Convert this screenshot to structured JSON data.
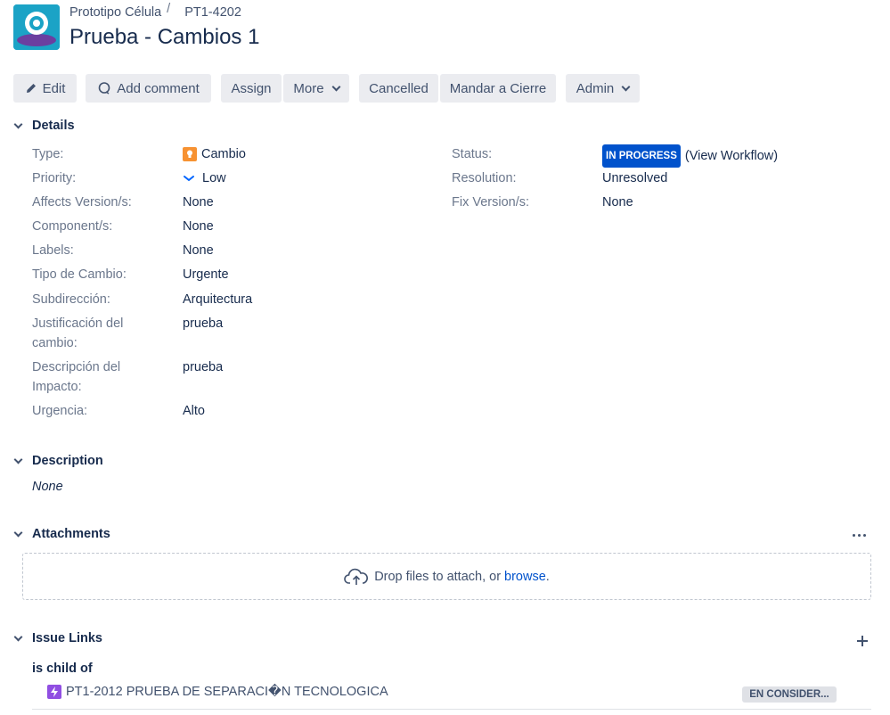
{
  "header": {
    "project_name": "Prototipo Célula",
    "issue_key": "PT1-4202",
    "title": "Prueba - Cambios 1"
  },
  "toolbar": {
    "edit": "Edit",
    "comment": "Comment",
    "comment_full": "Comment",
    "assign": "Assign",
    "more": "More",
    "cancelled": "Cancelled",
    "mandar": "Mandar a Cierre",
    "admin": "Admin"
  },
  "details": {
    "heading": "Details",
    "left": [
      {
        "label": "Type:",
        "value": "Cambio"
      },
      {
        "label": "Priority:",
        "value": "Low"
      },
      {
        "label": "Affects Version/s:",
        "value": "None"
      },
      {
        "label": "Component/s:",
        "value": "None"
      },
      {
        "label": "Labels:",
        "value": "None"
      },
      {
        "label": "Tipo de Cambio:",
        "value": "Urgente"
      },
      {
        "label": "Subdirección:",
        "value": "Arquitectura"
      },
      {
        "label": "Justificación del cambio:",
        "value": "prueba"
      },
      {
        "label": "Descripción del Impacto:",
        "value": "prueba"
      },
      {
        "label": "Urgencia:",
        "value": "Alto"
      }
    ],
    "right": [
      {
        "label": "Status:",
        "status": "IN PROGRESS",
        "link": "(View Workflow)"
      },
      {
        "label": "Resolution:",
        "value": "Unresolved"
      },
      {
        "label": "Fix Version/s:",
        "value": "None"
      }
    ]
  },
  "description": {
    "heading": "Description",
    "value": "None"
  },
  "attachments": {
    "heading": "Attachments",
    "drop_text": "Drop files to attach, or",
    "browse": "browse",
    "period": "."
  },
  "issue_links": {
    "heading": "Issue Links",
    "relation": "is child of",
    "items": [
      {
        "key_summary": "PT1-2012 PRUEBA DE SEPARACI�N TECNOLOGICA",
        "status": "EN CONSIDER..."
      }
    ]
  },
  "colors": {
    "status_blue": "#0052CC",
    "link_blue": "#0052CC",
    "cambio_orange": "#F79232",
    "epic_purple": "#904EE2",
    "avatar_teal": "#1BA3C6"
  }
}
